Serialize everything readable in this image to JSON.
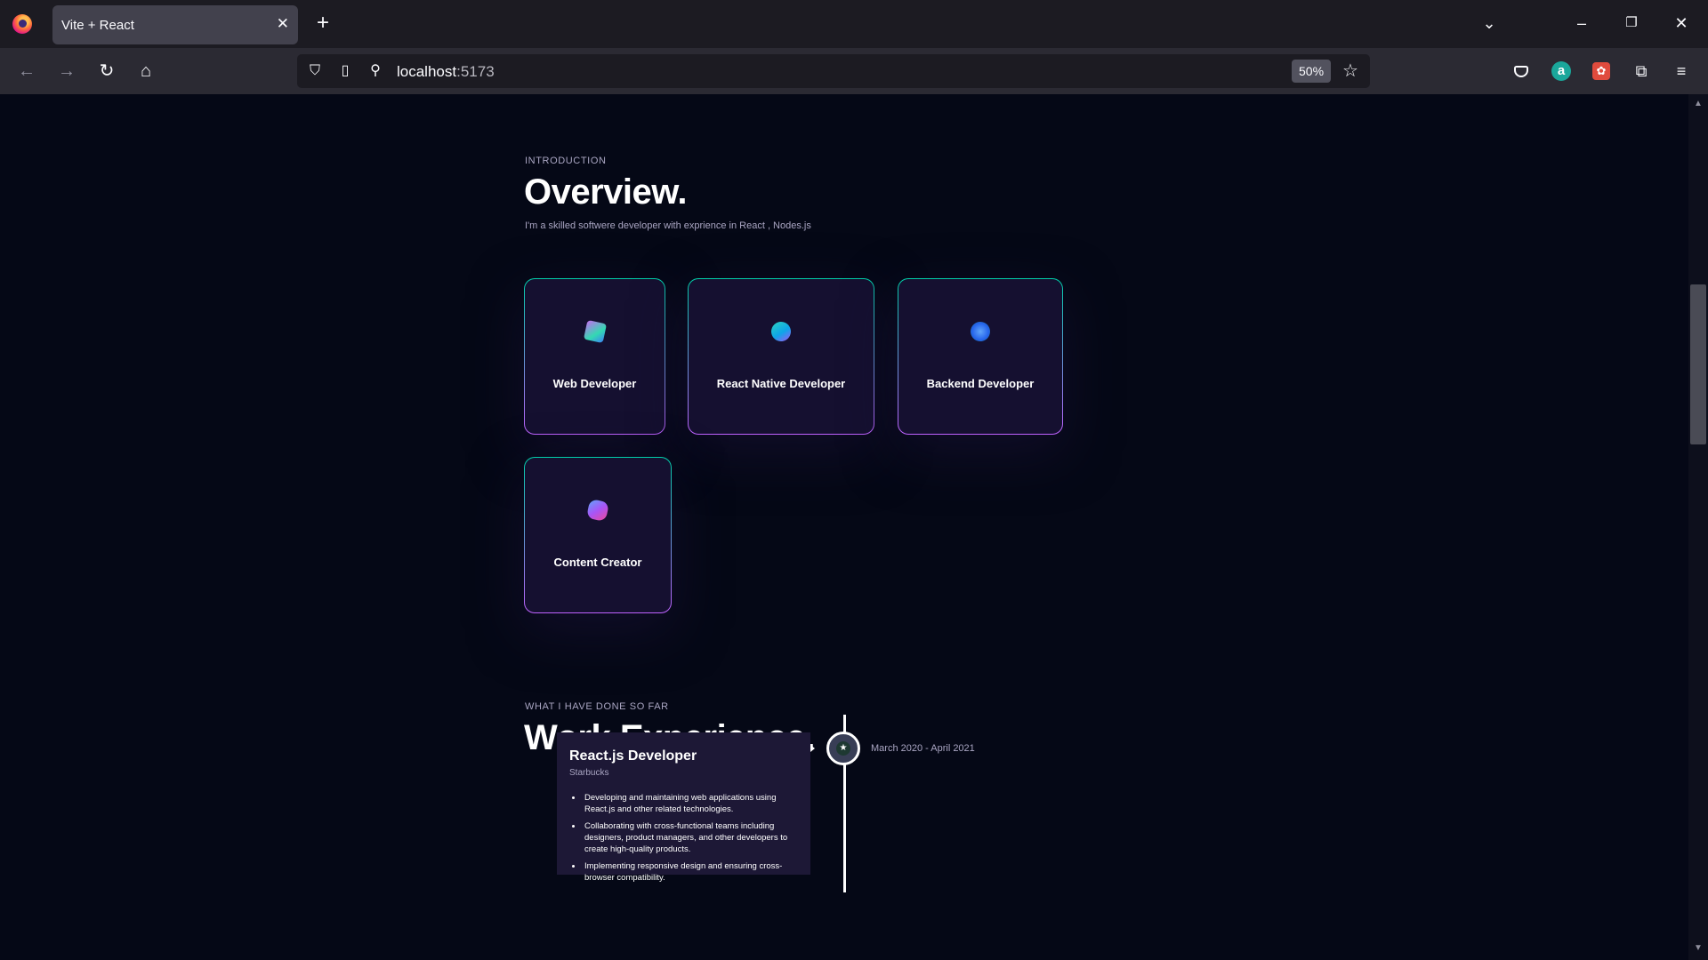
{
  "browser": {
    "tab_title": "Vite + React",
    "tab_close": "✕",
    "new_tab": "+",
    "url_host": "localhost",
    "url_port": ":5173",
    "zoom": "50%"
  },
  "overview": {
    "subtitle": "INTRODUCTION",
    "title": "Overview.",
    "intro": "I'm a skilled softwere developer with exprience in React , Nodes.js",
    "services": [
      {
        "title": "Web Developer",
        "icon": "web-dev-icon"
      },
      {
        "title": "React Native Developer",
        "icon": "react-native-icon"
      },
      {
        "title": "Backend Developer",
        "icon": "backend-icon"
      },
      {
        "title": "Content Creator",
        "icon": "content-creator-icon"
      }
    ]
  },
  "experience": {
    "subtitle": "WHAT I HAVE DONE SO FAR",
    "title": "Work Experience.",
    "items": [
      {
        "title": "React.js Developer",
        "company": "Starbucks",
        "date": "March 2020 - April 2021",
        "points": [
          "Developing and maintaining web applications using React.js and other related technologies.",
          "Collaborating with cross-functional teams including designers, product managers, and other developers to create high-quality products.",
          "Implementing responsive design and ensuring cross-browser compatibility."
        ]
      }
    ]
  },
  "colors": {
    "background": "#050816",
    "card": "#151030",
    "secondary_text": "#aaa6c3",
    "border_gradient_start": "#00cea8",
    "border_gradient_end": "#bf61ff",
    "experience_card": "#1d1836"
  }
}
